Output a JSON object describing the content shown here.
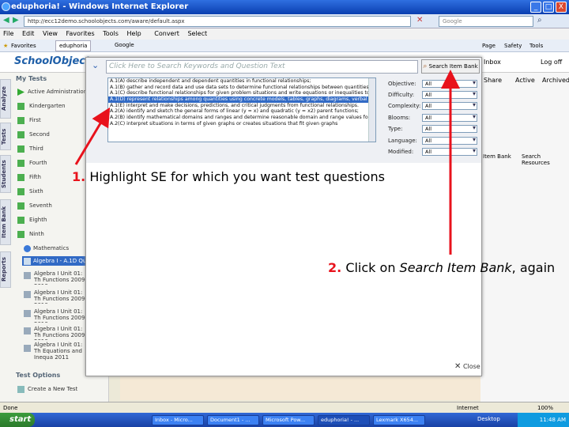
{
  "window": {
    "title": "eduphoria! - Windows Internet Explorer",
    "buttons": [
      "_",
      "□",
      "X"
    ]
  },
  "address": {
    "url": "http://ecc12demo.schoolobjects.com/aware/default.aspx",
    "search_placeholder": "Google"
  },
  "menu": {
    "items": [
      "File",
      "Edit",
      "View",
      "Favorites",
      "Tools",
      "Help"
    ],
    "convert": "Convert",
    "select": "Select"
  },
  "favorites": {
    "label": "Favorites",
    "tabs": [
      "eduphoria",
      "Google"
    ],
    "tools": [
      "Page",
      "Safety",
      "Tools"
    ]
  },
  "app": {
    "logo": "SchoolObjects aware",
    "header_right": [
      "Inbox",
      "Log off"
    ],
    "tabs_right": [
      "Share",
      "Active",
      "Archived"
    ],
    "right_buttons": [
      "Item Bank",
      "Search Resources"
    ]
  },
  "sidebar": {
    "section": "My Tests",
    "vtabs": [
      "Analyze",
      "Tests",
      "Students",
      "Item Bank",
      "Reports"
    ],
    "items": [
      "Active Administrations",
      "Kindergarten",
      "First",
      "Second",
      "Third",
      "Fourth",
      "Fifth",
      "Sixth",
      "Seventh",
      "Eighth",
      "Ninth",
      "Mathematics",
      "Algebra I - A.1D Quiz",
      "Algebra I Unit 01: Th Functions 2009-2010",
      "Algebra I Unit 01: Th Functions 2009-2010",
      "Algebra I Unit 01: Th Functions 2009-2010",
      "Algebra I Unit 01: Th Functions 2009-2010",
      "Algebra I Unit 01: Th Equations and Inequa 2011"
    ],
    "options_header": "Test Options",
    "create_new": "Create a New Test"
  },
  "modal": {
    "search_placeholder": "Click Here to Search Keywords and Question Text",
    "search_button": "Search Item Bank",
    "se_list": [
      "A.1(A) describe independent and dependent quantities in functional relationships;",
      "A.1(B) gather and record data and use data sets to determine functional relationships between quantities;",
      "A.1(C) describe functional relationships for given problem situations and write equations or inequalities to",
      "A.1(D) represent relationships among quantities using concrete models, tables, graphs, diagrams, verbal d",
      "A.1(E) interpret and make decisions, predictions, and critical judgments from functional relationships.",
      "A.2(A) identify and sketch the general forms of linear (y = x) and quadratic (y = x2) parent functions;",
      "A.2(B) identify mathematical domains and ranges and determine reasonable domain and range values for",
      "A.2(C) interpret situations in terms of given graphs or creates situations that fit given graphs"
    ],
    "selected_index": 3,
    "filters": [
      {
        "label": "Objective:",
        "value": "All"
      },
      {
        "label": "Difficulty:",
        "value": "All"
      },
      {
        "label": "Complexity:",
        "value": "All"
      },
      {
        "label": "Blooms:",
        "value": "All"
      },
      {
        "label": "Type:",
        "value": "All"
      },
      {
        "label": "Language:",
        "value": "All"
      },
      {
        "label": "Modified:",
        "value": "All"
      }
    ],
    "close": "Close"
  },
  "annotations": {
    "step1_number": "1.",
    "step1_text": "Highlight SE for which you want test questions",
    "step2_number": "2.",
    "step2_text_a": "Click on ",
    "step2_text_b": "Search Item Bank",
    "step2_text_c": ", again"
  },
  "status": {
    "text": "Done",
    "zone": "Internet",
    "zoom": "100%"
  },
  "taskbar": {
    "start": "start",
    "tasks": [
      "Inbox - Micro...",
      "Document1 - ...",
      "Microsoft Pow...",
      "eduphoria! - ...",
      "Lexmark X654..."
    ],
    "desktop": "Desktop",
    "clock": "11:48 AM"
  },
  "colors": {
    "arrow": "#e8121c",
    "selection": "#316ac5",
    "title_bar": "#0a3fb0"
  }
}
